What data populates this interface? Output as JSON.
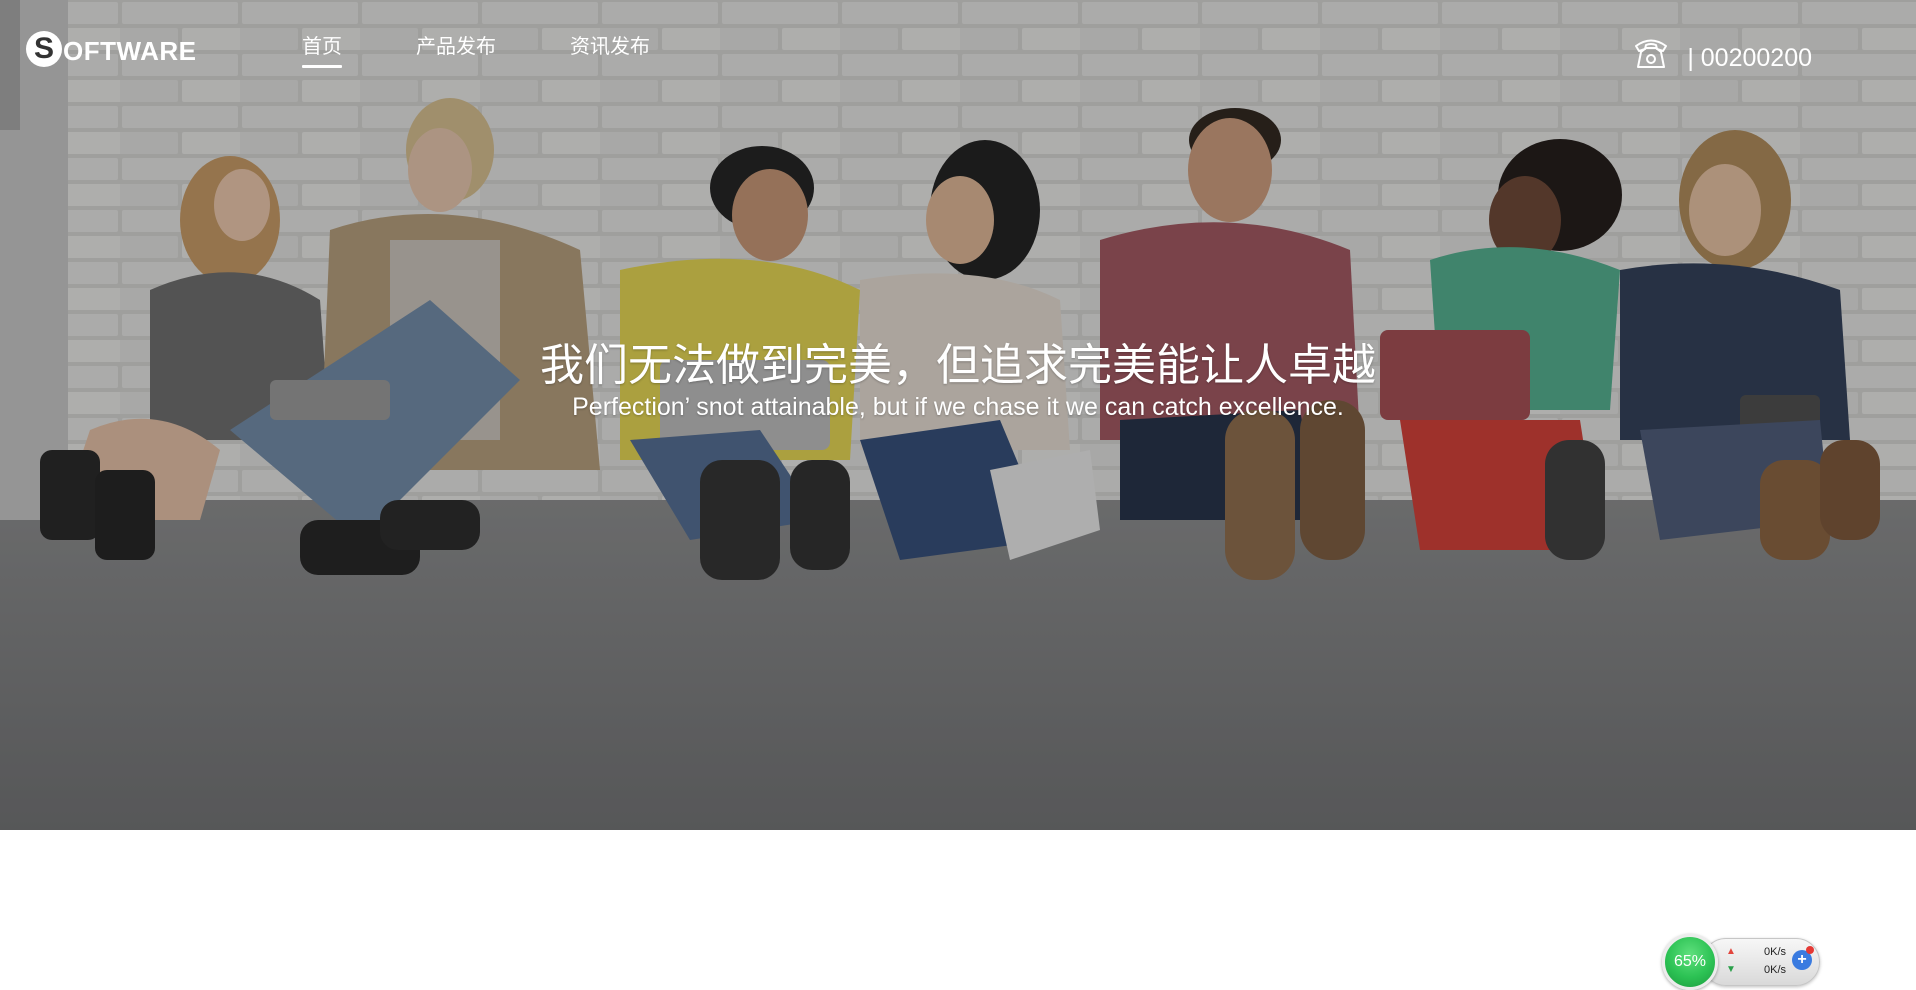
{
  "brand": {
    "logo_letter": "S",
    "logo_rest": "OFTWARE"
  },
  "nav": {
    "items": [
      {
        "label": "首页",
        "active": true
      },
      {
        "label": "产品发布",
        "active": false
      },
      {
        "label": "资讯发布",
        "active": false
      }
    ]
  },
  "contact": {
    "phone_text": "| 00200200",
    "icon": "telephone-icon"
  },
  "hero": {
    "headline": "我们无法做到完美，但追求完美能让人卓越",
    "subline": "Perfection’ snot attainable, but if we chase it we can catch excellence.",
    "photo": "group-of-people-sitting-against-brick-wall"
  },
  "speed_widget": {
    "percent": "65%",
    "upload": "0K/s",
    "download": "0K/s",
    "plus_icon": "plus-icon"
  },
  "colors": {
    "hero_overlay": "#3a3a3a",
    "text": "#ffffff",
    "page_bg": "#ffffff",
    "widget_green": "#2cc254",
    "widget_blue": "#3a7be0"
  }
}
